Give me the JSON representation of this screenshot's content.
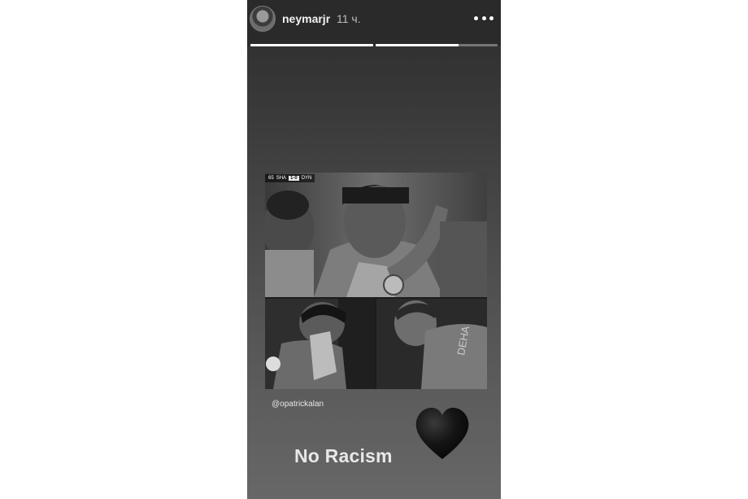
{
  "story": {
    "username": "neymarjr",
    "time_ago": "11 ч.",
    "progress_segments": [
      {
        "filled": 1.0
      },
      {
        "filled": 0.68
      }
    ],
    "scoreboard": {
      "left_text": "65",
      "home_team": "SHA",
      "score": "1-0",
      "away_team": "DYN"
    },
    "mention": "@opatrickalan",
    "caption": "No Racism",
    "icons": {
      "avatar": "avatar",
      "more": "more-icon",
      "heart": "black-heart-icon"
    },
    "colors": {
      "heart": "#111111",
      "caption": "#e8e8e8"
    }
  }
}
